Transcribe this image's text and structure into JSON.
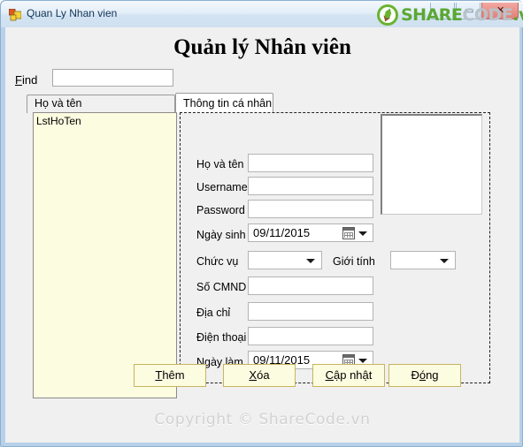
{
  "window": {
    "title": "Quan Ly Nhan vien",
    "app_icon": "vb-form-icon",
    "controls": {
      "minimize": "minimize-icon",
      "maximize": "maximize-icon",
      "close": "close-icon",
      "close_glyph": "✕",
      "minimize_glyph": "–",
      "maximize_glyph": "▭"
    },
    "frame_color": "#b8d0e8"
  },
  "watermark_logo": {
    "icon": "sharecode-recycle-logo",
    "part1": "SHARE",
    "part2": "CODE",
    "part3": ".vn",
    "color_green": "#5aa832",
    "color_grey": "#b9c2c9"
  },
  "page_title": "Quản lý Nhân viên",
  "search": {
    "label_accel": "F",
    "label_rest": "ind",
    "value": "",
    "placeholder": ""
  },
  "tabs": [
    {
      "label": "Họ và tên",
      "active": false
    },
    {
      "label": "Thông tin cá nhân",
      "active": true
    }
  ],
  "listbox": {
    "items": [
      "LstHoTen"
    ],
    "background": "#fcfce0"
  },
  "detail_form": {
    "fields": [
      {
        "label": "Họ và tên",
        "type": "text",
        "value": ""
      },
      {
        "label": "Username",
        "type": "text",
        "value": ""
      },
      {
        "label": "Password",
        "type": "text",
        "value": ""
      },
      {
        "label": "Ngày sinh",
        "type": "date",
        "value": "09/11/2015"
      },
      {
        "label": "Chức vụ",
        "type": "combo",
        "value": ""
      },
      {
        "label": "Giới tính",
        "type": "combo",
        "value": ""
      },
      {
        "label": "Số CMND",
        "type": "text",
        "value": ""
      },
      {
        "label": "Địa chỉ",
        "type": "text",
        "value": ""
      },
      {
        "label": "Điện thoại",
        "type": "text",
        "value": ""
      },
      {
        "label": "Ngày  làm",
        "type": "date",
        "value": "09/11/2015"
      }
    ],
    "photo_box": "employee-photo-placeholder"
  },
  "buttons": [
    {
      "accel": "Th",
      "accel_char": "T",
      "pre": "",
      "mid": "hêm",
      "label": "Thêm"
    },
    {
      "pre": "",
      "accel_char": "X",
      "mid": "óa",
      "label": "Xóa"
    },
    {
      "pre": "",
      "accel_char": "C",
      "mid": "ập nhật",
      "label": "Cập nhật"
    },
    {
      "pre": "Đ",
      "accel_char": "ó",
      "mid": "ng",
      "label": "Đóng"
    }
  ],
  "copyright": "Copyright © ShareCode.vn"
}
